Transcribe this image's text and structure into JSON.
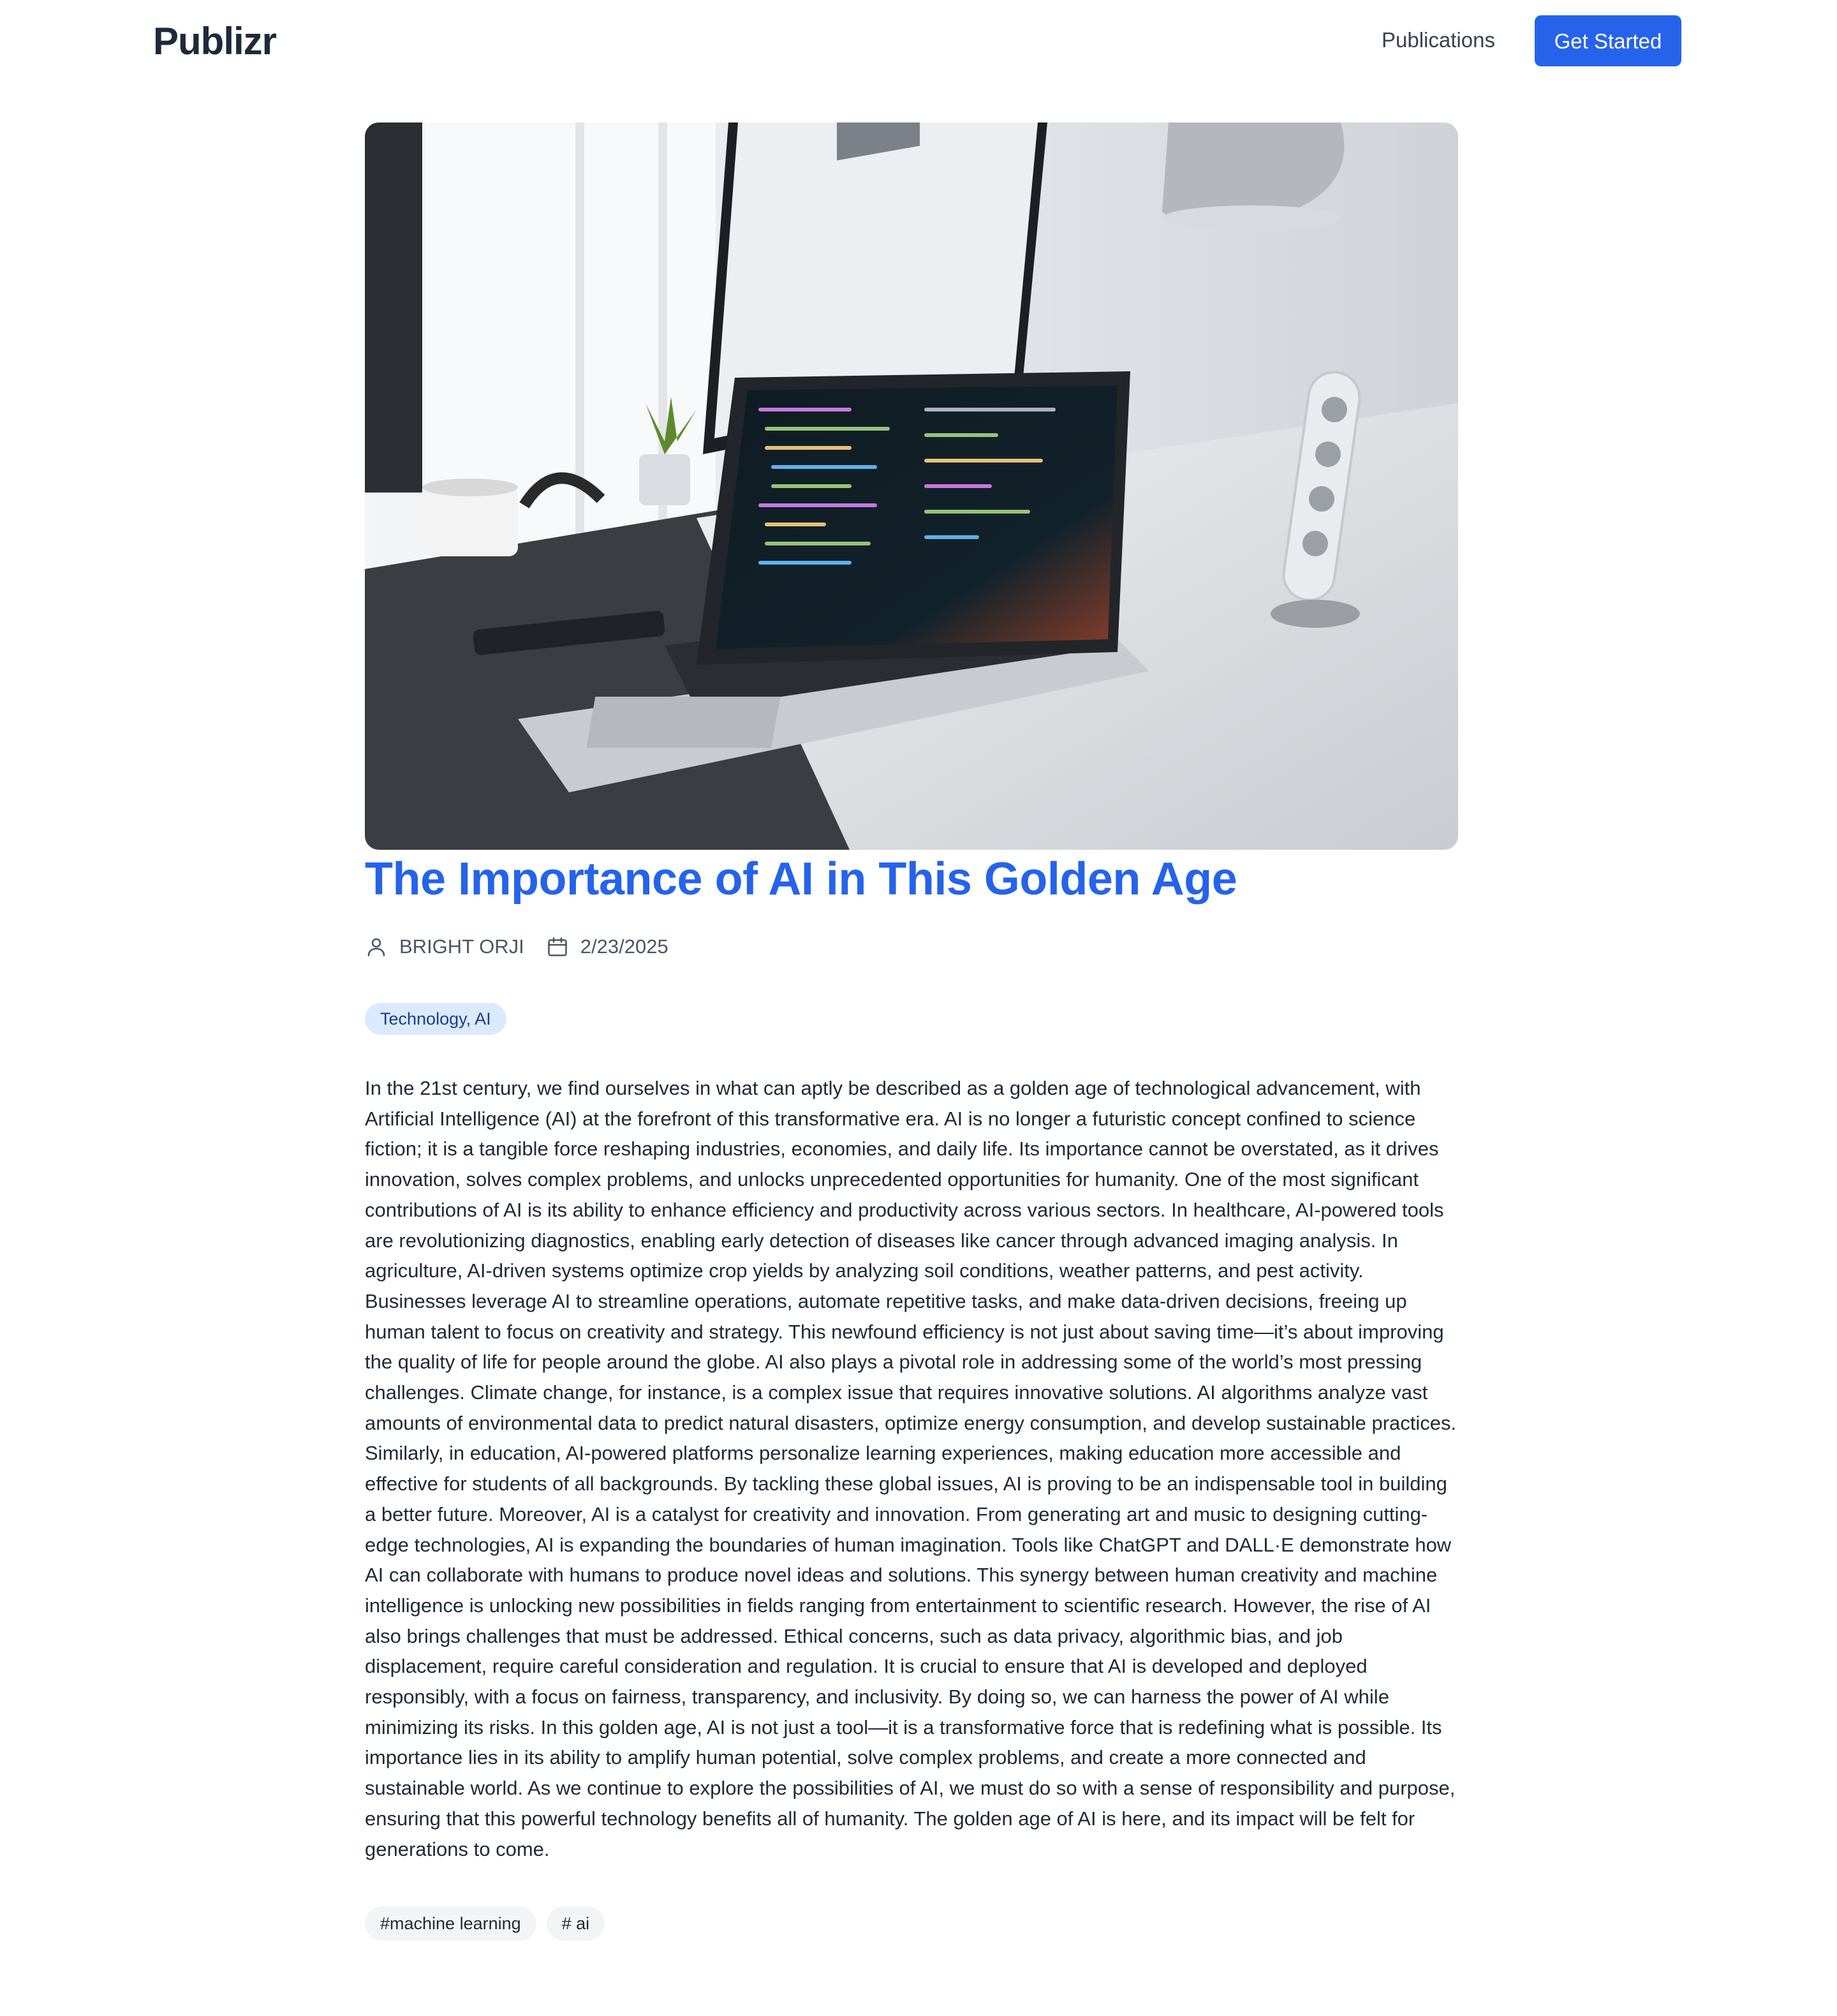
{
  "header": {
    "logo": "Publizr",
    "nav_publications": "Publications",
    "cta_label": "Get Started",
    "accent_color": "#2563eb"
  },
  "article": {
    "hero_alt": "laptop-on-desk-photo",
    "title": "The Importance of AI in This Golden Age",
    "author": "BRIGHT ORJI",
    "date": "2/23/2025",
    "category": "Technology, AI",
    "body": "In the 21st century, we find ourselves in what can aptly be described as a golden age of technological advancement, with Artificial Intelligence (AI) at the forefront of this transformative era. AI is no longer a futuristic concept confined to science fiction; it is a tangible force reshaping industries, economies, and daily life. Its importance cannot be overstated, as it drives innovation, solves complex problems, and unlocks unprecedented opportunities for humanity. One of the most significant contributions of AI is its ability to enhance efficiency and productivity across various sectors. In healthcare, AI-powered tools are revolutionizing diagnostics, enabling early detection of diseases like cancer through advanced imaging analysis. In agriculture, AI-driven systems optimize crop yields by analyzing soil conditions, weather patterns, and pest activity. Businesses leverage AI to streamline operations, automate repetitive tasks, and make data-driven decisions, freeing up human talent to focus on creativity and strategy. This newfound efficiency is not just about saving time—it’s about improving the quality of life for people around the globe. AI also plays a pivotal role in addressing some of the world’s most pressing challenges. Climate change, for instance, is a complex issue that requires innovative solutions. AI algorithms analyze vast amounts of environmental data to predict natural disasters, optimize energy consumption, and develop sustainable practices. Similarly, in education, AI-powered platforms personalize learning experiences, making education more accessible and effective for students of all backgrounds. By tackling these global issues, AI is proving to be an indispensable tool in building a better future. Moreover, AI is a catalyst for creativity and innovation. From generating art and music to designing cutting-edge technologies, AI is expanding the boundaries of human imagination. Tools like ChatGPT and DALL·E demonstrate how AI can collaborate with humans to produce novel ideas and solutions. This synergy between human creativity and machine intelligence is unlocking new possibilities in fields ranging from entertainment to scientific research. However, the rise of AI also brings challenges that must be addressed. Ethical concerns, such as data privacy, algorithmic bias, and job displacement, require careful consideration and regulation. It is crucial to ensure that AI is developed and deployed responsibly, with a focus on fairness, transparency, and inclusivity. By doing so, we can harness the power of AI while minimizing its risks. In this golden age, AI is not just a tool—it is a transformative force that is redefining what is possible. Its importance lies in its ability to amplify human potential, solve complex problems, and create a more connected and sustainable world. As we continue to explore the possibilities of AI, we must do so with a sense of responsibility and purpose, ensuring that this powerful technology benefits all of humanity. The golden age of AI is here, and its impact will be felt for generations to come.",
    "hashtags": [
      "#machine learning",
      "# ai"
    ]
  }
}
